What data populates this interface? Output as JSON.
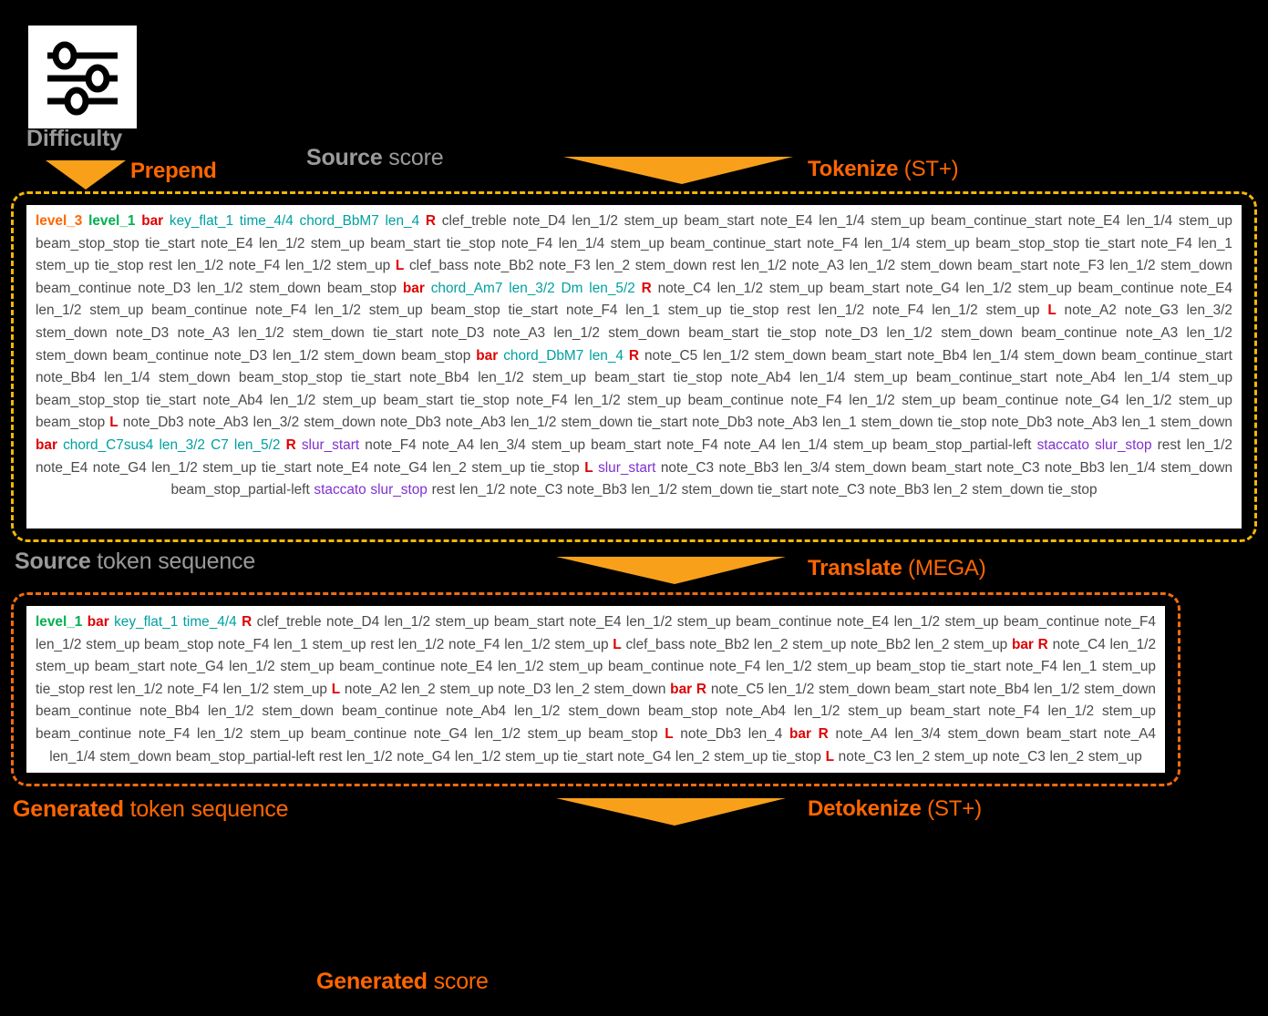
{
  "diagram": {
    "difficulty_label": "Difficulty",
    "icon": "sliders-icon",
    "stages": {
      "prepend": {
        "bold": "Prepend",
        "rest": ""
      },
      "source_score": {
        "bold": "Source",
        "rest": " score"
      },
      "tokenize": {
        "bold": "Tokenize",
        "rest": " (ST+)"
      },
      "source_token_sequence": {
        "bold": "Source",
        "rest": " token sequence"
      },
      "translate": {
        "bold": "Translate",
        "rest": " (MEGA)"
      },
      "generated_token_sequence": {
        "bold": "Generated",
        "rest": " token sequence"
      },
      "detokenize": {
        "bold": "Detokenize",
        "rest": " (ST+)"
      },
      "generated_score": {
        "bold": "Generated",
        "rest": " score"
      }
    },
    "colors": {
      "orange": "#ff6600",
      "gray": "#9a9a9a",
      "gold_border": "#f2b705",
      "orange_border": "#f26b0f",
      "token_level_high": "#ff6600",
      "token_level_low": "#00b050",
      "token_bar": "#e00000",
      "token_chord": "#00a0a0",
      "token_articulation": "#8030d0",
      "token_default": "#4a4a4a"
    }
  },
  "source_tokens": [
    {
      "t": "level_3",
      "c": "level3"
    },
    {
      "t": "level_1",
      "c": "level1"
    },
    {
      "t": "bar",
      "c": "bar"
    },
    {
      "t": "key_flat_1 time_4/4 chord_BbM7 len_4",
      "c": "chord"
    },
    {
      "t": "R",
      "c": "rl"
    },
    {
      "t": "clef_treble note_D4 len_1/2 stem_up beam_start note_E4 len_1/4 stem_up beam_continue_start note_E4 len_1/4 stem_up beam_stop_stop tie_start note_E4 len_1/2 stem_up beam_start tie_stop note_F4 len_1/4 stem_up beam_continue_start note_F4 len_1/4 stem_up beam_stop_stop tie_start note_F4 len_1 stem_up tie_stop rest len_1/2 note_F4 len_1/2 stem_up",
      "c": ""
    },
    {
      "t": "L",
      "c": "rl"
    },
    {
      "t": "clef_bass note_Bb2 note_F3 len_2 stem_down rest len_1/2 note_A3 len_1/2 stem_down beam_start note_F3 len_1/2 stem_down beam_continue note_D3 len_1/2 stem_down beam_stop",
      "c": ""
    },
    {
      "t": "bar",
      "c": "bar"
    },
    {
      "t": "chord_Am7 len_3/2 Dm len_5/2",
      "c": "chord"
    },
    {
      "t": "R",
      "c": "rl"
    },
    {
      "t": "note_C4 len_1/2 stem_up beam_start note_G4 len_1/2 stem_up beam_continue note_E4 len_1/2 stem_up beam_continue note_F4 len_1/2 stem_up beam_stop tie_start note_F4 len_1 stem_up tie_stop rest len_1/2 note_F4 len_1/2 stem_up",
      "c": ""
    },
    {
      "t": "L",
      "c": "rl"
    },
    {
      "t": "note_A2 note_G3 len_3/2 stem_down note_D3 note_A3 len_1/2 stem_down tie_start note_D3 note_A3 len_1/2 stem_down beam_start tie_stop note_D3 len_1/2 stem_down beam_continue note_A3 len_1/2 stem_down beam_continue note_D3 len_1/2 stem_down beam_stop",
      "c": ""
    },
    {
      "t": "bar",
      "c": "bar"
    },
    {
      "t": "chord_DbM7 len_4",
      "c": "chord"
    },
    {
      "t": "R",
      "c": "rl"
    },
    {
      "t": "note_C5 len_1/2 stem_down beam_start note_Bb4 len_1/4 stem_down beam_continue_start note_Bb4 len_1/4 stem_down beam_stop_stop tie_start note_Bb4 len_1/2 stem_up beam_start tie_stop note_Ab4 len_1/4 stem_up beam_continue_start note_Ab4 len_1/4 stem_up beam_stop_stop tie_start note_Ab4 len_1/2 stem_up beam_start tie_stop note_F4 len_1/2 stem_up beam_continue note_F4 len_1/2 stem_up beam_continue note_G4 len_1/2 stem_up beam_stop",
      "c": ""
    },
    {
      "t": "L",
      "c": "rl"
    },
    {
      "t": "note_Db3 note_Ab3 len_3/2 stem_down note_Db3 note_Ab3 len_1/2 stem_down tie_start note_Db3 note_Ab3 len_1 stem_down tie_stop note_Db3 note_Ab3 len_1 stem_down",
      "c": ""
    },
    {
      "t": "bar",
      "c": "bar"
    },
    {
      "t": "chord_C7sus4 len_3/2 C7 len_5/2",
      "c": "chord"
    },
    {
      "t": "R",
      "c": "rl"
    },
    {
      "t": "slur_start",
      "c": "artic"
    },
    {
      "t": "note_F4 note_A4 len_3/4 stem_up beam_start note_F4 note_A4 len_1/4 stem_up beam_stop_partial-left",
      "c": ""
    },
    {
      "t": "staccato slur_stop",
      "c": "artic"
    },
    {
      "t": "rest len_1/2 note_E4 note_G4 len_1/2 stem_up tie_start note_E4 note_G4 len_2 stem_up tie_stop",
      "c": ""
    },
    {
      "t": "L",
      "c": "rl"
    },
    {
      "t": "slur_start",
      "c": "artic"
    },
    {
      "t": "note_C3 note_Bb3 len_3/4 stem_down beam_start note_C3 note_Bb3 len_1/4 stem_down beam_stop_partial-left",
      "c": ""
    },
    {
      "t": "staccato slur_stop",
      "c": "artic"
    },
    {
      "t": "rest len_1/2 note_C3 note_Bb3 len_1/2 stem_down tie_start note_C3 note_Bb3 len_2 stem_down tie_stop",
      "c": ""
    }
  ],
  "generated_tokens": [
    {
      "t": "level_1",
      "c": "level1"
    },
    {
      "t": "bar",
      "c": "bar"
    },
    {
      "t": "key_flat_1 time_4/4",
      "c": "chord"
    },
    {
      "t": "R",
      "c": "rl"
    },
    {
      "t": "clef_treble note_D4 len_1/2 stem_up beam_start note_E4 len_1/2 stem_up beam_continue note_E4 len_1/2 stem_up beam_continue note_F4 len_1/2 stem_up beam_stop note_F4 len_1 stem_up rest len_1/2 note_F4 len_1/2 stem_up",
      "c": ""
    },
    {
      "t": "L",
      "c": "rl"
    },
    {
      "t": "clef_bass note_Bb2 len_2 stem_up note_Bb2 len_2 stem_up",
      "c": ""
    },
    {
      "t": "bar",
      "c": "bar"
    },
    {
      "t": "R",
      "c": "rl"
    },
    {
      "t": "note_C4 len_1/2 stem_up beam_start note_G4 len_1/2 stem_up beam_continue note_E4 len_1/2 stem_up beam_continue note_F4 len_1/2 stem_up beam_stop tie_start note_F4 len_1 stem_up tie_stop rest len_1/2 note_F4 len_1/2 stem_up",
      "c": ""
    },
    {
      "t": "L",
      "c": "rl"
    },
    {
      "t": "note_A2 len_2 stem_up note_D3 len_2 stem_down",
      "c": ""
    },
    {
      "t": "bar",
      "c": "bar"
    },
    {
      "t": "R",
      "c": "rl"
    },
    {
      "t": "note_C5 len_1/2 stem_down beam_start note_Bb4 len_1/2 stem_down beam_continue note_Bb4 len_1/2 stem_down beam_continue note_Ab4 len_1/2 stem_down beam_stop note_Ab4 len_1/2 stem_up beam_start note_F4 len_1/2 stem_up beam_continue note_F4 len_1/2 stem_up beam_continue note_G4 len_1/2 stem_up beam_stop",
      "c": ""
    },
    {
      "t": "L",
      "c": "rl"
    },
    {
      "t": "note_Db3 len_4",
      "c": ""
    },
    {
      "t": "bar",
      "c": "bar"
    },
    {
      "t": "R",
      "c": "rl"
    },
    {
      "t": "note_A4 len_3/4 stem_down beam_start note_A4 len_1/4 stem_down beam_stop_partial-left rest len_1/2 note_G4 len_1/2 stem_up tie_start note_G4 len_2 stem_up tie_stop",
      "c": ""
    },
    {
      "t": "L",
      "c": "rl"
    },
    {
      "t": "note_C3 len_2 stem_up note_C3 len_2 stem_up",
      "c": ""
    }
  ]
}
